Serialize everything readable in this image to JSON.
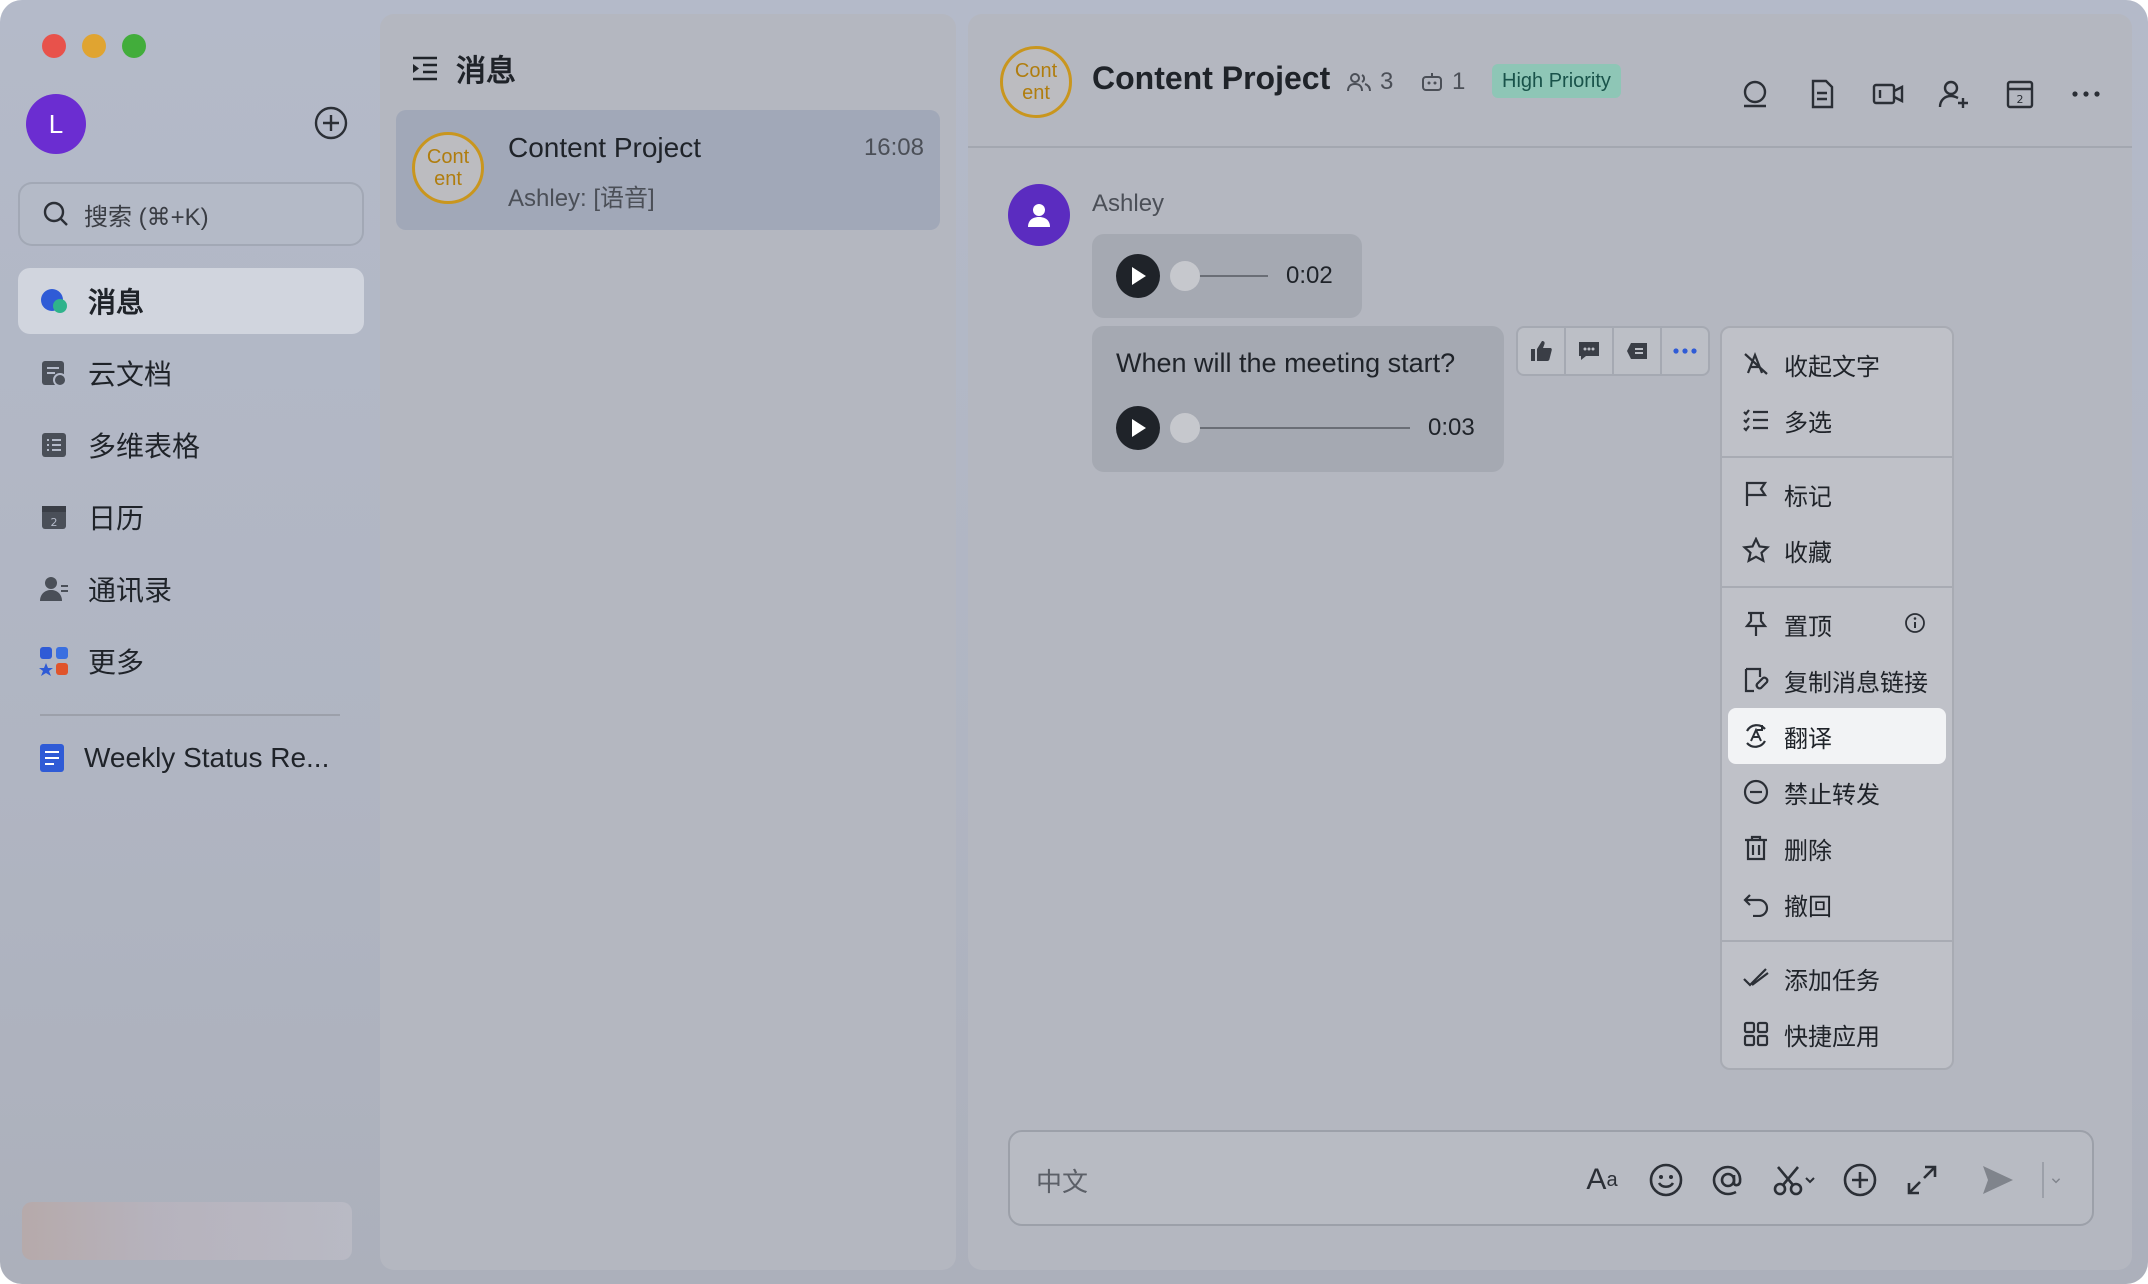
{
  "window": {
    "lights": [
      "close",
      "minimize",
      "maximize"
    ]
  },
  "sidebar": {
    "avatar_letter": "L",
    "search_placeholder": "搜索 (⌘+K)",
    "items": [
      {
        "label": "消息",
        "icon": "message-icon",
        "active": true
      },
      {
        "label": "云文档",
        "icon": "cloud-doc-icon"
      },
      {
        "label": "多维表格",
        "icon": "base-table-icon"
      },
      {
        "label": "日历",
        "icon": "calendar-icon"
      },
      {
        "label": "通讯录",
        "icon": "contacts-icon"
      },
      {
        "label": "更多",
        "icon": "more-apps-icon"
      }
    ],
    "pinned_doc": "Weekly Status Re..."
  },
  "middle": {
    "title": "消息",
    "conversations": [
      {
        "avatar_text": "Cont ent",
        "title": "Content Project",
        "time": "16:08",
        "preview": "Ashley: [语音]"
      }
    ]
  },
  "chat": {
    "avatar_text": "Cont ent",
    "title": "Content Project",
    "members": "3",
    "bots": "1",
    "badge": "High Priority",
    "sender": "Ashley",
    "voice1_duration": "0:02",
    "voice1_progress": 0,
    "message_text": "When will the meeting start?",
    "voice2_duration": "0:03",
    "voice2_progress": 0,
    "composer_placeholder": "中文",
    "colors": {
      "badge_bg": "#8ec6b6",
      "badge_text": "#19534a",
      "avatar_ring": "#c9961e"
    }
  },
  "menu": {
    "groups": [
      [
        "收起文字",
        "多选"
      ],
      [
        "标记",
        "收藏"
      ],
      [
        "置顶",
        "复制消息链接",
        "翻译",
        "禁止转发",
        "删除",
        "撤回"
      ],
      [
        "添加任务",
        "快捷应用"
      ]
    ],
    "highlighted": "翻译"
  }
}
